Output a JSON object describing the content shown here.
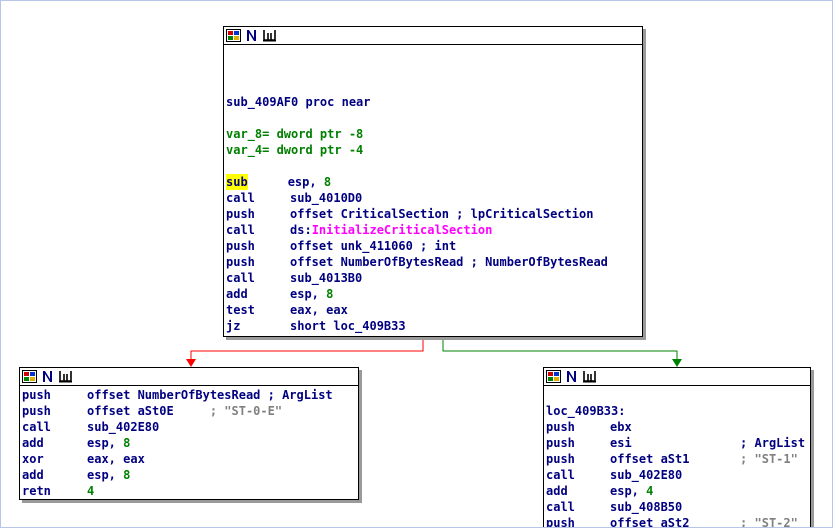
{
  "colors": {
    "mnemonic": "#000080",
    "number": "#008000",
    "import": "#ff00ff",
    "comment": "#808080",
    "highlight": "#ffff00",
    "edge_false": "#ff0000",
    "edge_true": "#008000"
  },
  "header_icons": [
    "graph-overview-icon",
    "node-name-icon",
    "node-comment-icon"
  ],
  "nodes": {
    "main": {
      "proc": "sub_409AF0 proc near",
      "var8": "var_8= dword ptr -8",
      "var4": "var_4= dword ptr -4",
      "lines": [
        {
          "mn": "sub",
          "ops": "esp, ",
          "num": "8"
        },
        {
          "mn": "call",
          "ops": "sub_4010D0"
        },
        {
          "mn": "push",
          "ops": "offset CriticalSection ",
          "cmt": "; lpCriticalSection"
        },
        {
          "mn": "call",
          "ops": "ds:",
          "imp": "InitializeCriticalSection"
        },
        {
          "mn": "push",
          "ops": "offset unk_411060 ",
          "cmt": "; int"
        },
        {
          "mn": "push",
          "ops": "offset NumberOfBytesRead ",
          "cmt": "; NumberOfBytesRead"
        },
        {
          "mn": "call",
          "ops": "sub_4013B0"
        },
        {
          "mn": "add",
          "ops": "esp, ",
          "num": "8"
        },
        {
          "mn": "test",
          "ops": "eax, eax"
        },
        {
          "mn": "jz",
          "ops": "short loc_409B33"
        }
      ]
    },
    "left": {
      "lines": [
        {
          "mn": "push",
          "ops": "offset NumberOfBytesRead ",
          "cmt": "; ArgList"
        },
        {
          "mn": "push",
          "ops": "offset aSt0E     ",
          "cmt2": "; \"ST-0-E\""
        },
        {
          "mn": "call",
          "ops": "sub_402E80"
        },
        {
          "mn": "add",
          "ops": "esp, ",
          "num": "8"
        },
        {
          "mn": "xor",
          "ops": "eax, eax"
        },
        {
          "mn": "add",
          "ops": "esp, ",
          "num": "8"
        },
        {
          "mn": "retn",
          "ops": "",
          "num": "4"
        }
      ]
    },
    "right": {
      "label": "loc_409B33:",
      "lines": [
        {
          "mn": "push",
          "ops": "ebx"
        },
        {
          "mn": "push",
          "ops": "esi               ",
          "cmt": "; ArgList"
        },
        {
          "mn": "push",
          "ops": "offset aSt1       ",
          "cmt2": "; \"ST-1\""
        },
        {
          "mn": "call",
          "ops": "sub_402E80"
        },
        {
          "mn": "add",
          "ops": "esp, ",
          "num": "4"
        },
        {
          "mn": "call",
          "ops": "sub_408B50"
        },
        {
          "mn": "push",
          "ops": "offset aSt2       ",
          "cmt2": "; \"ST-2\""
        }
      ]
    }
  }
}
